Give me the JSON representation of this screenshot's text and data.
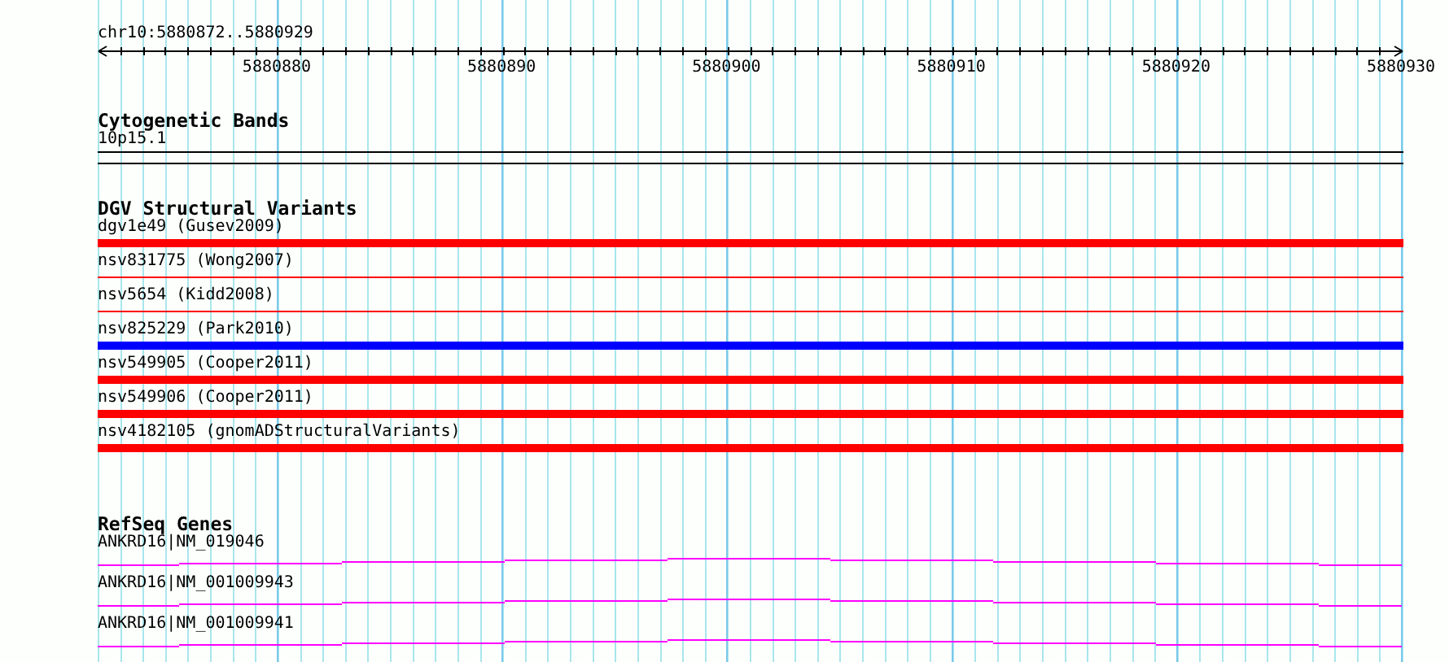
{
  "position": "chr10:5880872..5880929",
  "ruler": {
    "labels": [
      "5880880",
      "5880890",
      "5880900",
      "5880910",
      "5880920",
      "5880930"
    ]
  },
  "tracks": [
    {
      "kind": "bands",
      "title": "Cytogenetic Bands",
      "items": [
        {
          "label": "10p15.1"
        }
      ]
    },
    {
      "kind": "variants",
      "title": "DGV Structural Variants",
      "items": [
        {
          "label": "dgv1e49 (Gusev2009)",
          "kind": "thick",
          "color": "#ff0000"
        },
        {
          "label": "nsv831775 (Wong2007)",
          "kind": "thin",
          "color": "#ff0000"
        },
        {
          "label": "nsv5654 (Kidd2008)",
          "kind": "thin",
          "color": "#ff0000"
        },
        {
          "label": "nsv825229 (Park2010)",
          "kind": "thick",
          "color": "#0000ff"
        },
        {
          "label": "nsv549905 (Cooper2011)",
          "kind": "thick",
          "color": "#ff0000"
        },
        {
          "label": "nsv549906 (Cooper2011)",
          "kind": "thick",
          "color": "#ff0000"
        },
        {
          "label": "nsv4182105 (gnomADStructuralVariants)",
          "kind": "thick",
          "color": "#ff0000"
        }
      ]
    },
    {
      "kind": "genes",
      "title": "RefSeq Genes",
      "items": [
        {
          "label": "ANKRD16|NM_019046"
        },
        {
          "label": "ANKRD16|NM_001009943"
        },
        {
          "label": "ANKRD16|NM_001009941"
        }
      ]
    }
  ]
}
